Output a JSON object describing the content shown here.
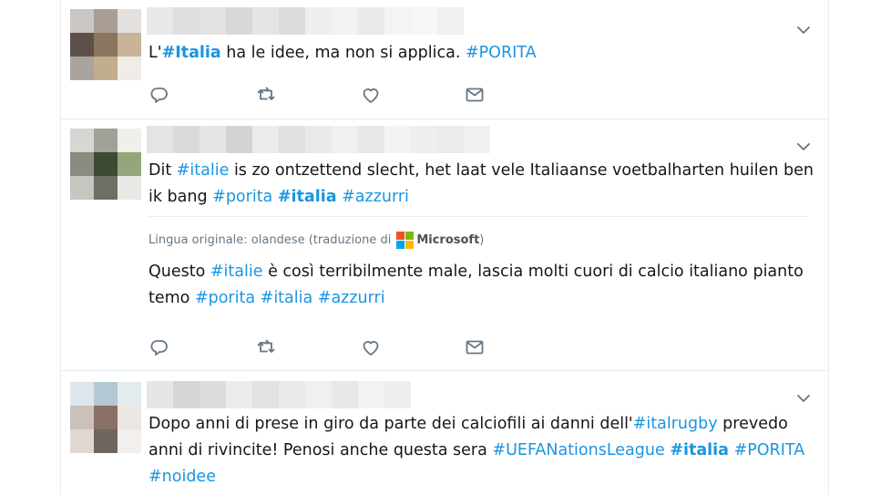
{
  "tweets": [
    {
      "text_parts": [
        {
          "text": "L'",
          "type": "plain"
        },
        {
          "text": "#Italia",
          "type": "tag-bold"
        },
        {
          "text": " ha le idee, ma non si applica. ",
          "type": "plain"
        },
        {
          "text": "#PORITA",
          "type": "tag"
        }
      ]
    },
    {
      "text_parts": [
        {
          "text": "Dit ",
          "type": "plain"
        },
        {
          "text": "#italie",
          "type": "tag"
        },
        {
          "text": " is zo ontzettend slecht, het laat vele Italiaanse voetbalharten huilen ben ik bang ",
          "type": "plain"
        },
        {
          "text": "#porita",
          "type": "tag"
        },
        {
          "text": " ",
          "type": "plain"
        },
        {
          "text": "#italia",
          "type": "tag-bold"
        },
        {
          "text": " ",
          "type": "plain"
        },
        {
          "text": "#azzurri",
          "type": "tag"
        }
      ],
      "translation": {
        "meta_label": "Lingua originale: olandese (traduzione di",
        "provider": "Microsoft",
        "closing": ")",
        "text_parts": [
          {
            "text": "Questo ",
            "type": "plain"
          },
          {
            "text": "#italie",
            "type": "tag"
          },
          {
            "text": " è così terribilmente male, lascia molti cuori di calcio italiano pianto temo ",
            "type": "plain"
          },
          {
            "text": "#porita",
            "type": "tag"
          },
          {
            "text": " ",
            "type": "plain"
          },
          {
            "text": "#italia",
            "type": "tag"
          },
          {
            "text": " ",
            "type": "plain"
          },
          {
            "text": "#azzurri",
            "type": "tag"
          }
        ]
      }
    },
    {
      "text_parts": [
        {
          "text": "Dopo anni di prese in giro da parte dei calciofili ai danni dell'",
          "type": "plain"
        },
        {
          "text": "#italrugby",
          "type": "tag"
        },
        {
          "text": " prevedo anni di rivincite! Penosi anche questa sera ",
          "type": "plain"
        },
        {
          "text": "#UEFANationsLeague",
          "type": "tag"
        },
        {
          "text": " ",
          "type": "plain"
        },
        {
          "text": "#italia",
          "type": "tag-bold"
        },
        {
          "text": " ",
          "type": "plain"
        },
        {
          "text": "#PORITA",
          "type": "tag"
        },
        {
          "text": " ",
          "type": "plain"
        },
        {
          "text": "#noidee",
          "type": "tag"
        }
      ]
    }
  ],
  "action_icons": [
    "reply-icon",
    "retweet-icon",
    "like-icon",
    "direct-message-icon"
  ],
  "colors": {
    "hashtag": "#1b95e0",
    "text": "#14171a",
    "meta": "#657786",
    "icon": "#657786",
    "border": "#e6ecf0"
  }
}
